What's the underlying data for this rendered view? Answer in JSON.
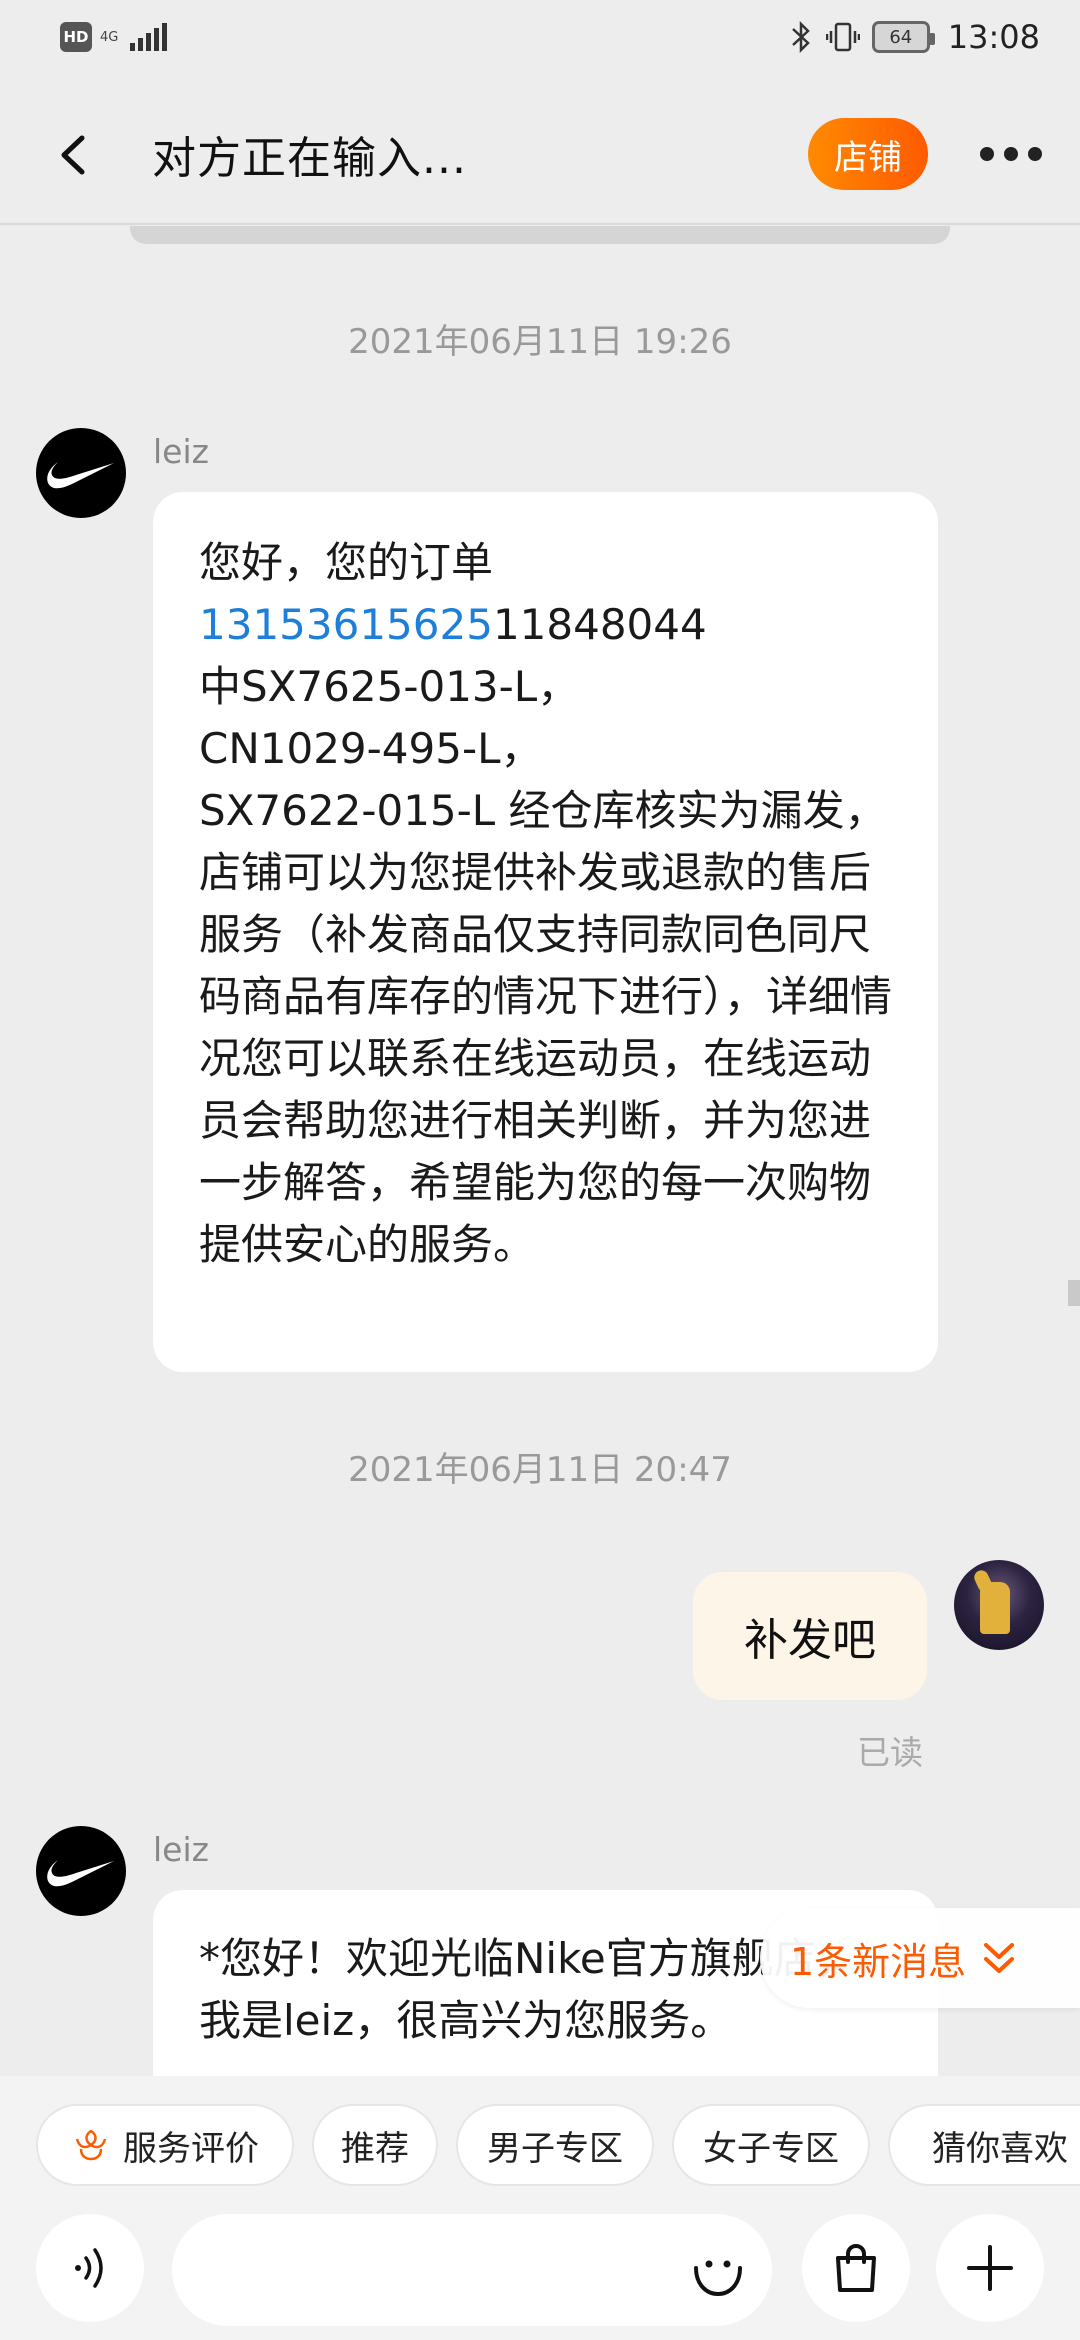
{
  "status_bar": {
    "hd_label": "HD",
    "network": "4G",
    "battery": "64",
    "time": "13:08"
  },
  "header": {
    "title": "对方正在输入...",
    "shop_button": "店铺"
  },
  "messages": [
    {
      "type": "timestamp",
      "text": "2021年06月11日 19:26"
    },
    {
      "type": "incoming",
      "sender": "leiz",
      "link": "1315361562511848044",
      "link_highlighted": "13153615625",
      "link_rest": "11848044",
      "line_before": "您好，您的订单",
      "text_after": "中SX7625-013-L，\nCN1029-495-L，\nSX7622-015-L 经仓库核实为漏发，店铺可以为您提供补发或退款的售后服务（补发商品仅支持同款同色同尺码商品有库存的情况下进行），详细情况您可以联系在线运动员，在线运动员会帮助您进行相关判断，并为您进一步解答，希望能为您的每一次购物提供安心的服务。"
    },
    {
      "type": "timestamp",
      "text": "2021年06月11日 20:47"
    },
    {
      "type": "outgoing",
      "text": "补发吧",
      "status": "已读"
    },
    {
      "type": "incoming",
      "sender": "leiz",
      "text": "*您好！欢迎光临Nike官方旗舰店，我是leiz，很高兴为您服务。"
    }
  ],
  "new_message_pill": "1条新消息",
  "quick_actions": [
    "服务评价",
    "推荐",
    "男子专区",
    "女子专区",
    "猜你喜欢"
  ],
  "icons": {
    "back": "chevron-left-icon",
    "more": "more-dots-icon",
    "voice": "voice-icon",
    "emoji": "smiley-icon",
    "bag": "shopping-bag-icon",
    "plus": "plus-icon",
    "review": "flower-icon"
  },
  "colors": {
    "accent": "#ff5a00",
    "link": "#1e7fd8",
    "outgoing_bubble": "#fdf5e7"
  }
}
